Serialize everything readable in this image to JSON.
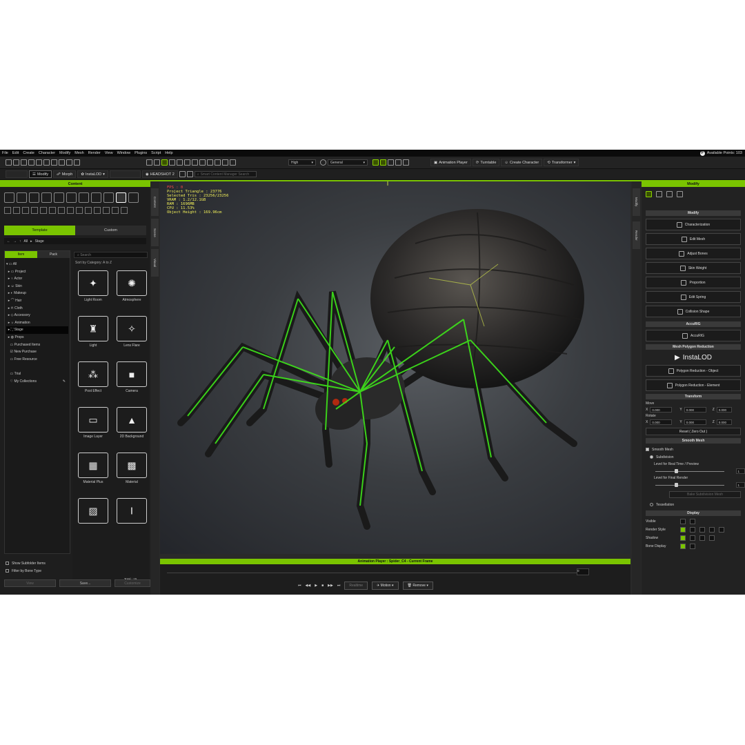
{
  "menu": [
    "File",
    "Edit",
    "Create",
    "Character",
    "Modify",
    "Mesh",
    "Render",
    "View",
    "Window",
    "Plugins",
    "Script",
    "Help"
  ],
  "points": {
    "icon": "P",
    "label": "Available Points: 103"
  },
  "toolbar": {
    "quality": "High",
    "shader": "General",
    "animation_player": "Animation Player",
    "turntable": "Turntable",
    "create_character": "Create Character",
    "transformer": "Transformer"
  },
  "toolbar2": {
    "modify": "Modify",
    "morph": "Morph",
    "instalod": "InstaLOD",
    "headshot": "HEADSHOT 2",
    "search_placeholder": "Smart Content Manager Search"
  },
  "content": {
    "title": "Content",
    "tab_template": "Template",
    "tab_custom": "Custom",
    "path": [
      "All",
      "Stage"
    ],
    "subtab_item": "Item",
    "subtab_pack": "Pack",
    "search": "Search",
    "sort": "Sort by Category: A to Z",
    "tree": [
      "All",
      "Project",
      "Actor",
      "Skin",
      "Makeup",
      "Hair",
      "Cloth",
      "Accessory",
      "Animation",
      "Stage",
      "Props",
      "Purchased Items",
      "New Purchase",
      "Free Resource",
      "",
      "Trial",
      "My Collections"
    ],
    "cards": [
      "Light Room",
      "Atmosphere",
      "Light",
      "Lens Flare",
      "Post Effect",
      "Camera",
      "Image Layer",
      "2D Background",
      "Material Plus",
      "Material"
    ],
    "show_subfolder": "Show Subfolder Items",
    "filter_bone": "Filter by Bone Type",
    "total": "Total : 15",
    "btn_view": "View",
    "btn_save": "Save...",
    "btn_custom": "Customize"
  },
  "side_tabs": {
    "content": "Content",
    "scene": "Scene",
    "visual": "Visual",
    "modify": "Modify",
    "render": "Render"
  },
  "stats": {
    "fps": "FPS : 0",
    "lines": [
      "Project Triangle : 23776",
      "Selected Tris : 23256/23256",
      "VRAM : 1.2/12.1GB",
      "RAM : 1696MB",
      "CPU : 11.53%",
      "Object Height : 169.96cm"
    ]
  },
  "anim": {
    "title": "Animation Player : Spider_C4 - Current Frame",
    "realtime": "Realtime",
    "motion": "Motion",
    "remove": "Remove",
    "frame": "0"
  },
  "modify": {
    "title": "Modify",
    "sec_modify": "Modify",
    "buttons": [
      "Characterization",
      "Edit Mesh",
      "Adjust Bones",
      "Skin Weight",
      "Proportion",
      "Edit Spring",
      "Collision Shape"
    ],
    "sec_accurig": "AccuRIG",
    "accurig": "AccuRIG",
    "sec_reduction": "Mesh Polygon Reduction",
    "instalod": "InstaLOD",
    "reduce_obj": "Polygon Reduction - Object",
    "reduce_el": "Polygon Reduction - Element",
    "sec_transform": "Transform",
    "move": "Move",
    "rotate": "Rotate",
    "x": "X",
    "y": "Y",
    "z": "Z",
    "val": "0.000",
    "reset": "Reset ( Zero Out )",
    "sec_smooth": "Smooth Mesh",
    "smooth_mesh": "Smooth Mesh",
    "subdivision": "Subdivision",
    "level_rt": "Level for Real Time / Preview",
    "level_rt_val": "1",
    "level_final": "Level for Final Render",
    "level_final_val": "1",
    "bake": "Bake Subdivision Mesh",
    "tessellation": "Tessellation",
    "sec_display": "Display",
    "visible": "Visible",
    "render_style": "Render Style",
    "shadow": "Shadow",
    "bone_display": "Bone Display"
  },
  "colors": {
    "accent": "#7ac400",
    "panel": "#1e1e1e",
    "stats": "#f4f25a"
  }
}
